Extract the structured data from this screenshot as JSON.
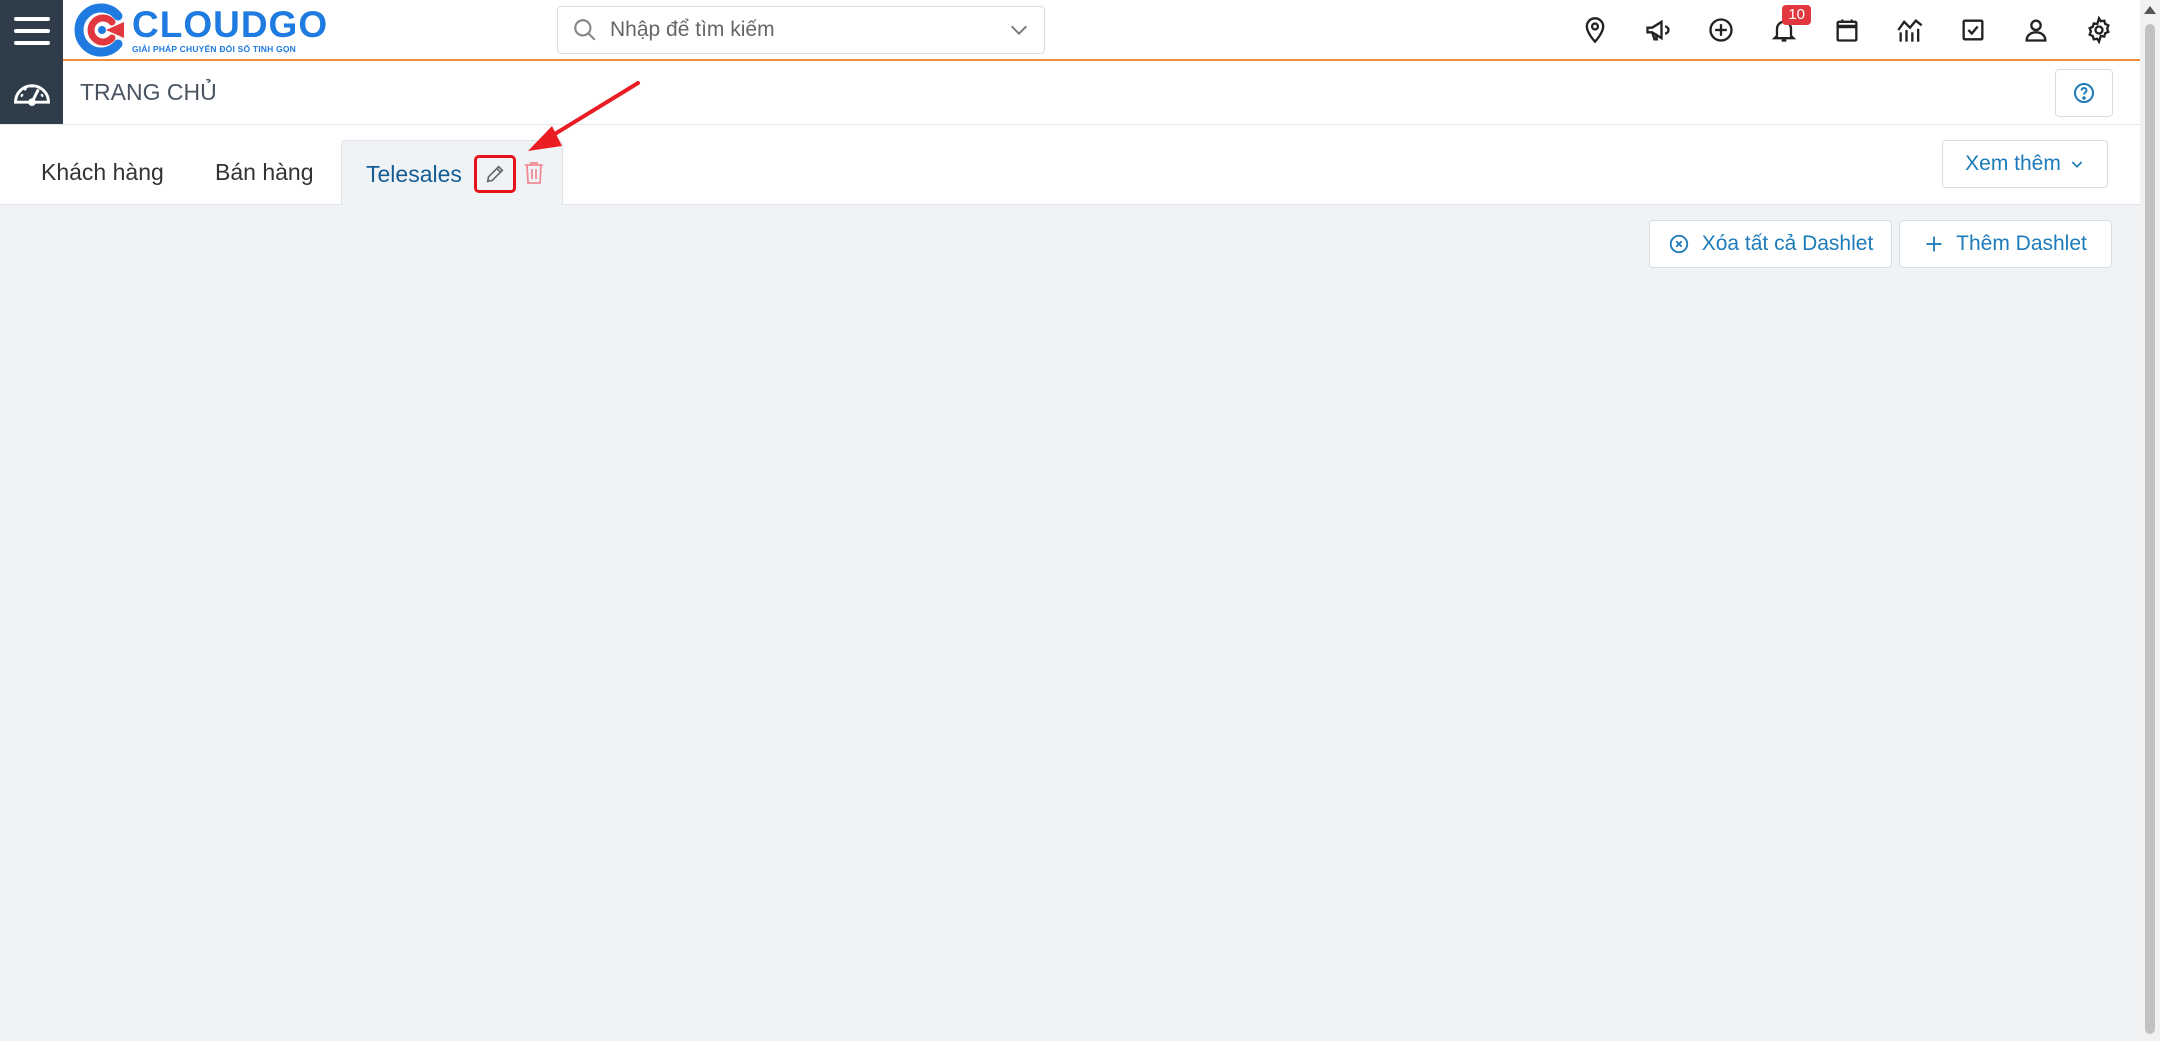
{
  "brand": {
    "name": "CLOUDGO",
    "tagline": "GIẢI PHÁP CHUYỂN ĐỔI SỐ TINH GỌN",
    "color": "#1f7be0",
    "accent": "#e0383e"
  },
  "search": {
    "placeholder": "Nhập để tìm kiếm",
    "value": ""
  },
  "top_icons": [
    "location-pin-icon",
    "megaphone-icon",
    "plus-circle-icon",
    "bell-icon",
    "calendar-icon",
    "chart-icon",
    "checkbox-icon",
    "user-icon",
    "gear-icon"
  ],
  "notifications": {
    "count": "10"
  },
  "header": {
    "title": "TRANG CHỦ"
  },
  "tabs": {
    "items": [
      {
        "label": "Khách hàng"
      },
      {
        "label": "Bán hàng"
      },
      {
        "label": "Telesales",
        "active": true
      }
    ]
  },
  "more": {
    "label": "Xem thêm"
  },
  "actions": {
    "clear_all": "Xóa tất cả Dashlet",
    "add": "Thêm Dashlet"
  },
  "colors": {
    "sidebar_dark": "#2f3d4a",
    "topbar_border": "#f28c3a",
    "link_blue": "#1c7bb8",
    "active_tab_text": "#145c93",
    "highlight_red": "#e8121b",
    "background": "#eff3f6"
  }
}
